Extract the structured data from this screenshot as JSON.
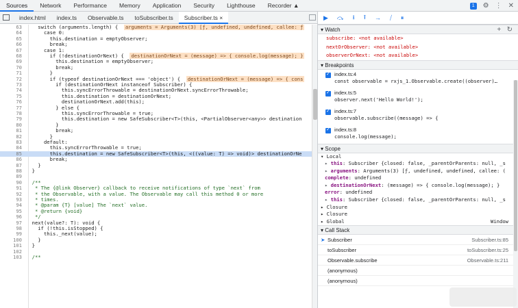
{
  "top_tabs": [
    "Sources",
    "Network",
    "Performance",
    "Memory",
    "Application",
    "Security",
    "Lighthouse",
    "Recorder ▲"
  ],
  "top_right": {
    "badge": "1",
    "gear": "⚙",
    "more": "⋮",
    "close": "✕"
  },
  "file_tabs": [
    {
      "label": "index.html"
    },
    {
      "label": "index.ts"
    },
    {
      "label": "Observable.ts"
    },
    {
      "label": "toSubscriber.ts"
    },
    {
      "label": "Subscriber.ts ×"
    }
  ],
  "code_lines": [
    {
      "n": "63",
      "t": "    switch (arguments.length) {",
      "hl": "arguments = Arguments(3) [ƒ, undefined, undefined, callee: ƒ"
    },
    {
      "n": "64",
      "t": "      case 0:"
    },
    {
      "n": "65",
      "t": "        this.destination = emptyObserver;"
    },
    {
      "n": "66",
      "t": "        break;"
    },
    {
      "n": "67",
      "t": "      case 1:"
    },
    {
      "n": "68",
      "t": "        if (!destinationOrNext) {",
      "hl": "destinationOrNext = (message) => { console.log(message); }"
    },
    {
      "n": "69",
      "t": "          this.destination = emptyObserver;"
    },
    {
      "n": "70",
      "t": "          break;"
    },
    {
      "n": "71",
      "t": "        }"
    },
    {
      "n": "72",
      "t": "        if (typeof destinationOrNext === 'object') {",
      "hl": "destinationOrNext = (message) => { cons"
    },
    {
      "n": "73",
      "t": "          if (destinationOrNext instanceof Subscriber) {"
    },
    {
      "n": "74",
      "t": "            this.syncErrorThrowable = destinationOrNext.syncErrorThrowable;"
    },
    {
      "n": "75",
      "t": "            this.destination = destinationOrNext;"
    },
    {
      "n": "76",
      "t": "            destinationOrNext.add(this);"
    },
    {
      "n": "77",
      "t": "          } else {"
    },
    {
      "n": "78",
      "t": "            this.syncErrorThrowable = true;"
    },
    {
      "n": "79",
      "t": "            this.destination = new SafeSubscriber<T>(this, <PartialObserver<any>> destination"
    },
    {
      "n": "80",
      "t": "          }"
    },
    {
      "n": "81",
      "t": "          break;"
    },
    {
      "n": "82",
      "t": "        }"
    },
    {
      "n": "83",
      "t": "      default:"
    },
    {
      "n": "84",
      "t": "        this.syncErrorThrowable = true;"
    },
    {
      "n": "85",
      "t": "        this.destination = new SafeSubscriber<T>(this, <((value: T) => void)> destinationOrNe",
      "exec": true
    },
    {
      "n": "86",
      "t": "        break;"
    },
    {
      "n": "87",
      "t": "    }"
    },
    {
      "n": "88",
      "t": "  }"
    },
    {
      "n": "89",
      "t": ""
    },
    {
      "n": "90",
      "t": "  /**",
      "cm": true
    },
    {
      "n": "91",
      "t": "   * The {@link Observer} callback to receive notifications of type `next` from",
      "cm": true
    },
    {
      "n": "92",
      "t": "   * the Observable, with a value. The Observable may call this method 0 or more",
      "cm": true
    },
    {
      "n": "93",
      "t": "   * times.",
      "cm": true
    },
    {
      "n": "94",
      "t": "   * @param {T} [value] The `next` value.",
      "cm": true
    },
    {
      "n": "95",
      "t": "   * @return {void}",
      "cm": true
    },
    {
      "n": "96",
      "t": "   */",
      "cm": true
    },
    {
      "n": "97",
      "t": "  next(value?: T): void {"
    },
    {
      "n": "98",
      "t": "    if (!this.isStopped) {"
    },
    {
      "n": "99",
      "t": "      this._next(value);"
    },
    {
      "n": "100",
      "t": "    }"
    },
    {
      "n": "101",
      "t": "  }"
    },
    {
      "n": "102",
      "t": ""
    },
    {
      "n": "103",
      "t": "  /**",
      "cm": true
    }
  ],
  "debugger": {
    "toolbar": [
      "▶",
      "⤼",
      "⭳",
      "⭱",
      "→",
      "⧸",
      "⏸"
    ],
    "watch": {
      "title": "▾ Watch",
      "add": "+",
      "refresh": "↻",
      "rows": [
        {
          "name": "subscribe",
          "value": "<not available>"
        },
        {
          "name": "nextOrObserver",
          "value": "<not available>"
        },
        {
          "name": "observerOrNext",
          "value": "<not available>"
        }
      ]
    },
    "breakpoints": {
      "title": "▾ Breakpoints",
      "items": [
        {
          "file": "index.ts:4",
          "code": "const observable = rxjs_1.Observable.create((observer)…"
        },
        {
          "file": "index.ts:5",
          "code": "observer.next('Hello World!');"
        },
        {
          "file": "index.ts:7",
          "code": "observable.subscribe((message) => {"
        },
        {
          "file": "index.ts:8",
          "code": "console.log(message);"
        }
      ]
    },
    "scope": {
      "title": "▾ Scope",
      "local": "▾ Local",
      "rows": [
        {
          "prefix": "▸ ",
          "key": "this",
          "val": ": Subscriber {closed: false, _parentOrParents: null, _s"
        },
        {
          "prefix": "▸ ",
          "key": "arguments",
          "val": ": Arguments(3) [ƒ, undefined, undefined, callee: ("
        },
        {
          "prefix": "  ",
          "key": "complete",
          "val": ": undefined"
        },
        {
          "prefix": "▸ ",
          "key": "destinationOrNext",
          "val": ": (message) => { console.log(message); }"
        },
        {
          "prefix": "  ",
          "key": "error",
          "val": ": undefined"
        },
        {
          "prefix": "▸ ",
          "key": "this",
          "val": ": Subscriber {closed: false, _parentOrParents: null, _s"
        }
      ],
      "closures": [
        "▸ Closure",
        "▸ Closure"
      ],
      "global": "▸ Global",
      "global_value": "Window"
    },
    "call_stack": {
      "title": "▾ Call Stack",
      "frames": [
        {
          "fn": "Subscriber",
          "loc": "Subscriber.ts:85",
          "current": true
        },
        {
          "fn": "toSubscriber",
          "loc": "toSubscriber.ts:25"
        },
        {
          "fn": "Observable.subscribe",
          "loc": "Observable.ts:211"
        },
        {
          "fn": "(anonymous)",
          "loc": ""
        },
        {
          "fn": "(anonymous)",
          "loc": ""
        }
      ]
    }
  }
}
